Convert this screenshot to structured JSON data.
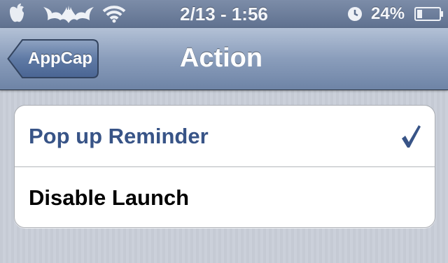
{
  "status_bar": {
    "time": "2/13 - 1:56",
    "battery_percent": "24%",
    "battery_level": 0.24,
    "icons": [
      "apple-icon",
      "batman-logo-icon",
      "wifi-icon",
      "clock-icon",
      "battery-icon"
    ]
  },
  "nav_bar": {
    "back_label": "AppCap",
    "title": "Action"
  },
  "options": [
    {
      "label": "Pop up Reminder",
      "selected": true
    },
    {
      "label": "Disable Launch",
      "selected": false
    }
  ],
  "colors": {
    "nav_gradient_top": "#b3c1d6",
    "nav_gradient_bottom": "#6e84a6",
    "selected_text": "#385487",
    "background": "#c7ccd6"
  }
}
